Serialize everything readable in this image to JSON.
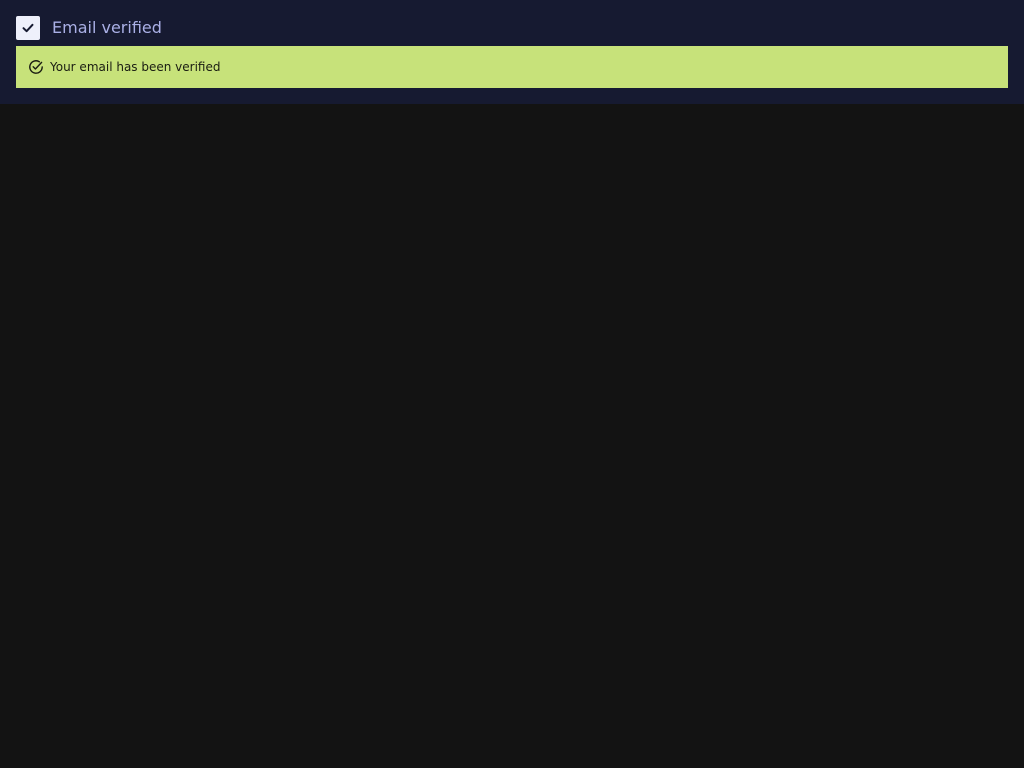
{
  "verification": {
    "checkbox_checked": true,
    "checkbox_label": "Email verified",
    "checkbox_icon": "checkmark-icon"
  },
  "banner": {
    "message": "Your email has been verified",
    "icon": "check-circle-icon",
    "background_color": "#c7e27a"
  },
  "colors": {
    "panel_background": "#161a31",
    "page_background": "#131313",
    "label_color": "#aab0e6"
  }
}
